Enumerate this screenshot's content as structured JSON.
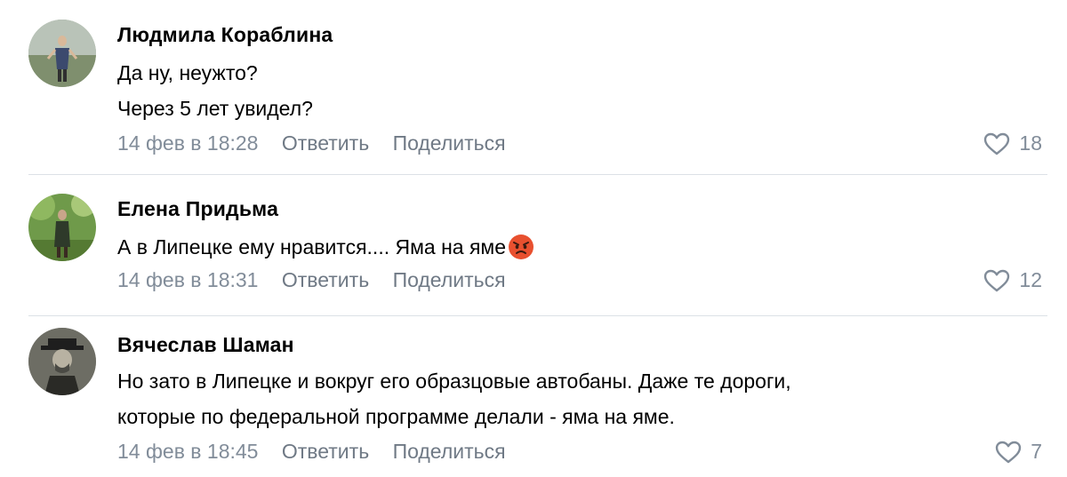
{
  "comments": [
    {
      "author": "Людмила Кораблина",
      "avatar_icon": "avatar-photo-woman-standing",
      "text_lines": [
        "Да ну, неужто?",
        "Через 5 лет увидел?"
      ],
      "date": "14 фев в 18:28",
      "reply_label": "Ответить",
      "share_label": "Поделиться",
      "likes": "18"
    },
    {
      "author": "Елена Придьма",
      "avatar_icon": "avatar-photo-woman-in-park",
      "text_lines": [
        "А в Липецке ему нравится.... Яма на яме"
      ],
      "emoji": "angry-face-emoji",
      "date": "14 фев в 18:31",
      "reply_label": "Ответить",
      "share_label": "Поделиться",
      "likes": "12"
    },
    {
      "author": "Вячеслав Шаман",
      "avatar_icon": "avatar-photo-man-with-hat",
      "text_lines": [
        "Но зато в Липецке и вокруг его образцовые автобаны. Даже те дороги,",
        "которые по федеральной программе делали - яма на яме."
      ],
      "date": "14 фев в 18:45",
      "reply_label": "Ответить",
      "share_label": "Поделиться",
      "likes": "7"
    }
  ],
  "colors": {
    "text": "#000000",
    "meta": "#818c99",
    "divider": "#dce1e6",
    "heart_outline": "#818c99"
  }
}
